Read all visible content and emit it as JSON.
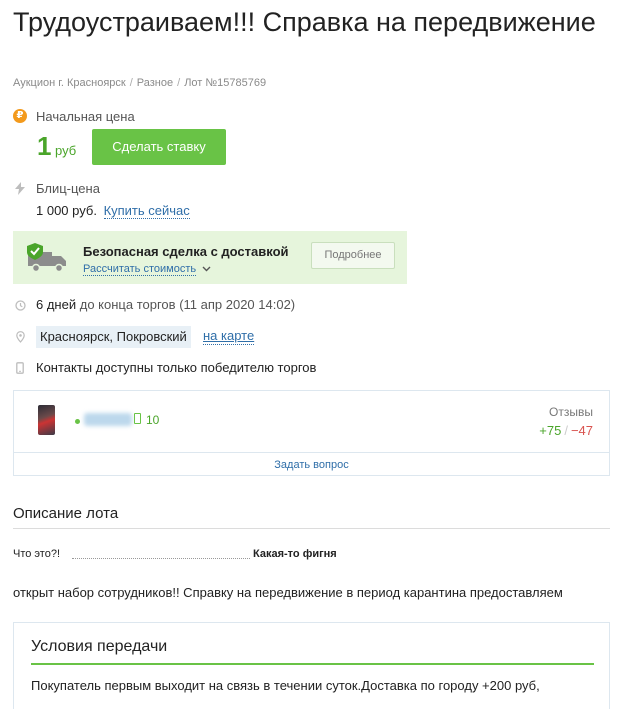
{
  "lot": {
    "title": "Трудоустраиваем!!! Справка на передвижение"
  },
  "breadcrumb": {
    "items": [
      "Аукцион г. Красноярск",
      "Разное",
      "Лот №15785769"
    ],
    "separator": "/"
  },
  "start_price": {
    "label": "Начальная цена",
    "value": "1",
    "currency": "руб",
    "bid_button": "Сделать ставку",
    "icon": "ruble-coin-icon"
  },
  "blitz": {
    "label": "Блиц-цена",
    "value": "1 000 руб.",
    "buy_link": "Купить сейчас",
    "icon": "lightning-icon"
  },
  "safe_deal": {
    "title": "Безопасная сделка с доставкой",
    "calc_link": "Рассчитать стоимость",
    "more_button": "Подробнее",
    "icon": "delivery-truck-icon"
  },
  "time_left": {
    "value": "6 дней",
    "suffix": "до конца торгов",
    "end_date": "(11 апр 2020 14:02)",
    "icon": "clock-icon"
  },
  "location": {
    "value": "Красноярск, Покровский",
    "map_link": "на карте",
    "icon": "map-pin-icon"
  },
  "contacts": {
    "text": "Контакты доступны только победителю торгов",
    "icon": "phone-icon"
  },
  "seller": {
    "phone_count": "10",
    "reviews_label": "Отзывы",
    "reviews_positive": "+75",
    "reviews_negative": "−47",
    "ask_question": "Задать вопрос"
  },
  "description": {
    "section_title": "Описание лота",
    "spec_key": "Что это?!",
    "spec_value": "Какая-то фигня",
    "text": "открыт набор сотрудников!! Справку на передвижение в период карантина предоставляем"
  },
  "conditions": {
    "title": "Условия передачи",
    "text": "Покупатель первым выходит на связь в течении суток.Доставка по городу +200 руб,"
  },
  "colors": {
    "accent_green": "#69c346",
    "price_green": "#4aa52a",
    "link_blue": "#2f6ea8",
    "ruble_orange": "#f39a1c",
    "negative_red": "#d9534f"
  }
}
